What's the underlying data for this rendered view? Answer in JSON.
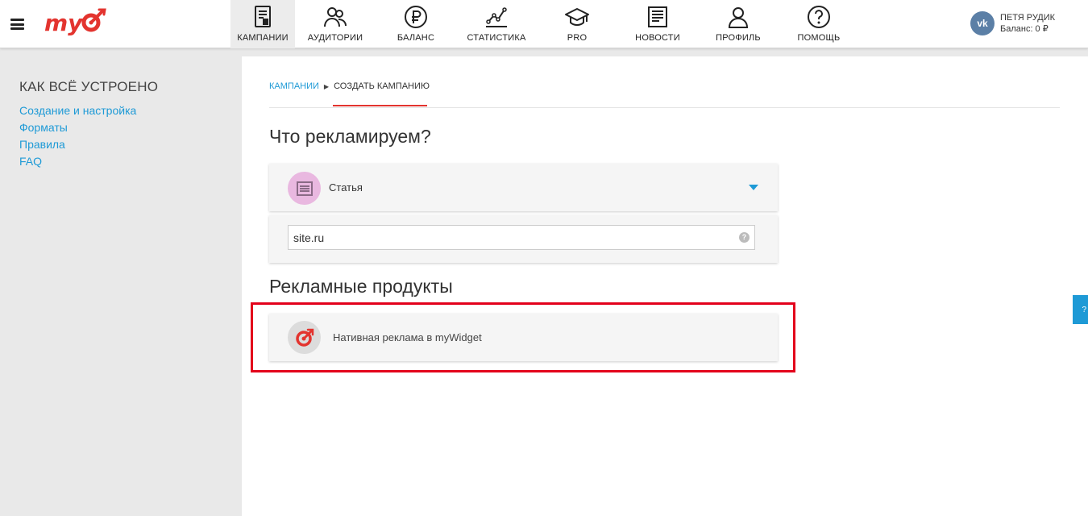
{
  "brand": {
    "logo_text": "my",
    "accent": "#e3342f",
    "link": "#1e9ad6"
  },
  "nav": [
    {
      "label": "КАМПАНИИ",
      "icon": "campaigns-icon",
      "active": true
    },
    {
      "label": "АУДИТОРИИ",
      "icon": "audiences-icon"
    },
    {
      "label": "БАЛАНС",
      "icon": "ruble-icon"
    },
    {
      "label": "СТАТИСТИКА",
      "icon": "statistics-icon"
    },
    {
      "label": "PRO",
      "icon": "graduation-cap-icon"
    },
    {
      "label": "НОВОСТИ",
      "icon": "news-icon"
    },
    {
      "label": "ПРОФИЛЬ",
      "icon": "profile-icon"
    },
    {
      "label": "ПОМОЩЬ",
      "icon": "help-icon"
    }
  ],
  "user": {
    "name": "ПЕТЯ РУДИК",
    "balance_label": "Баланс: 0 ₽",
    "avatar_text": "vk"
  },
  "sidebar": {
    "heading": "КАК ВСЁ УСТРОЕНО",
    "links": [
      "Создание и настройка",
      "Форматы",
      "Правила",
      "FAQ"
    ]
  },
  "breadcrumb": {
    "link": "КАМПАНИИ",
    "separator": "▶",
    "current": "СОЗДАТЬ КАМПАНИЮ"
  },
  "what_section": {
    "title": "Что рекламируем?",
    "selected_type": "Статья",
    "url_value": "site.ru",
    "help": "?"
  },
  "products_section": {
    "title": "Рекламные продукты",
    "product_label": "Нативная реклама в myWidget"
  },
  "side_tab": {
    "label": "?"
  }
}
